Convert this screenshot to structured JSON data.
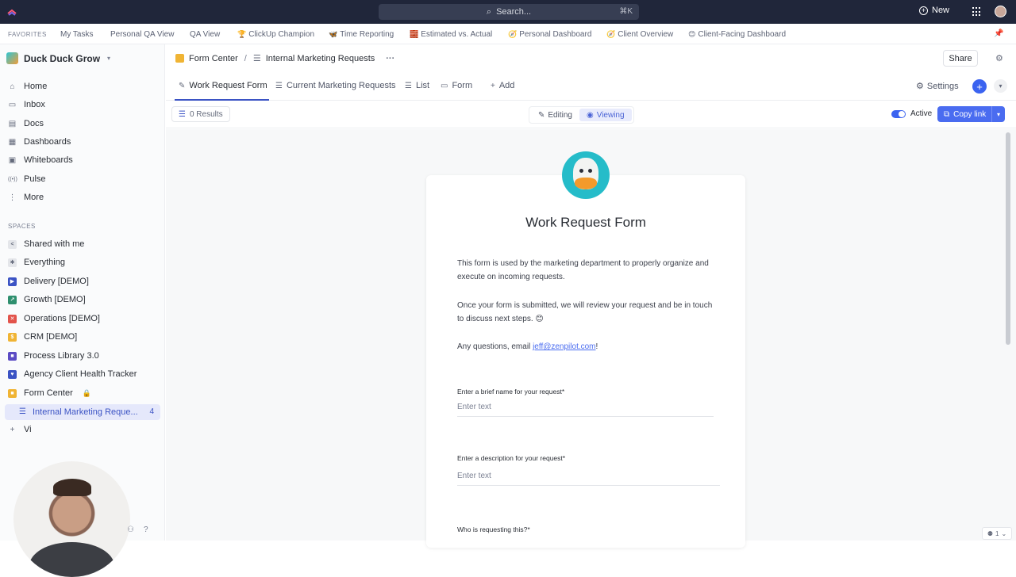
{
  "topbar": {
    "search_placeholder": "Search...",
    "search_shortcut": "⌘K",
    "new_label": "New"
  },
  "favorites": {
    "title": "FAVORITES",
    "items": [
      {
        "label": "My Tasks",
        "emoji": ""
      },
      {
        "label": "Personal QA View",
        "emoji": ""
      },
      {
        "label": "QA View",
        "emoji": ""
      },
      {
        "label": "ClickUp Champion",
        "emoji": "🏆"
      },
      {
        "label": "Time Reporting",
        "emoji": "🦋"
      },
      {
        "label": "Estimated vs. Actual",
        "emoji": "🧱"
      },
      {
        "label": "Personal Dashboard",
        "emoji": "🧭"
      },
      {
        "label": "Client Overview",
        "emoji": "🧭"
      },
      {
        "label": "Client-Facing Dashboard",
        "emoji": "😊"
      }
    ]
  },
  "sidebar": {
    "workspace": "Duck Duck Grow",
    "nav": [
      {
        "label": "Home",
        "icon": "⌂"
      },
      {
        "label": "Inbox",
        "icon": "▭"
      },
      {
        "label": "Docs",
        "icon": "▤"
      },
      {
        "label": "Dashboards",
        "icon": "▦"
      },
      {
        "label": "Whiteboards",
        "icon": "▣"
      },
      {
        "label": "Pulse",
        "icon": "((•))"
      },
      {
        "label": "More",
        "icon": "⋮"
      }
    ],
    "spaces_title": "SPACES",
    "spaces": [
      {
        "label": "Shared with me",
        "icon": "<",
        "color": "#e4e6ea"
      },
      {
        "label": "Everything",
        "icon": "✱",
        "color": "#e4e6ea"
      },
      {
        "label": "Delivery [DEMO]",
        "icon": "▶",
        "color": "#3b53c4"
      },
      {
        "label": "Growth [DEMO]",
        "icon": "↗",
        "color": "#2e8f6e"
      },
      {
        "label": "Operations [DEMO]",
        "icon": "✕",
        "color": "#e2534b"
      },
      {
        "label": "CRM [DEMO]",
        "icon": "$",
        "color": "#f0b434"
      },
      {
        "label": "Process Library 3.0",
        "icon": "■",
        "color": "#5b4bc4"
      },
      {
        "label": "Agency Client Health Tracker",
        "icon": "♥",
        "color": "#3b53c4"
      },
      {
        "label": "Form Center",
        "icon": "■",
        "color": "#f0b434"
      }
    ],
    "active_item": {
      "label": "Internal Marketing Reque...",
      "count": "4"
    },
    "partial_item": "Vi"
  },
  "header": {
    "breadcrumb_parent": "Form Center",
    "breadcrumb_current": "Internal Marketing Requests",
    "share_label": "Share"
  },
  "tabs": [
    {
      "label": "Work Request Form",
      "icon": "✎"
    },
    {
      "label": "Current Marketing Requests",
      "icon": "☰"
    },
    {
      "label": "List",
      "icon": "☰"
    },
    {
      "label": "Form",
      "icon": "▭"
    },
    {
      "label": "Add",
      "icon": "+"
    }
  ],
  "settings_label": "Settings",
  "toolbar": {
    "results": "0 Results",
    "editing": "Editing",
    "viewing": "Viewing",
    "active_label": "Active",
    "copy_link": "Copy link"
  },
  "form": {
    "title": "Work Request Form",
    "para1": "This form is used by the marketing department to properly organize and execute on incoming requests.",
    "para2": "Once your form is submitted, we will review your request and be in touch to discuss next steps. 😊",
    "para3_prefix": "Any questions, email ",
    "para3_link": "jeff@zenpilot.com",
    "para3_suffix": "!",
    "q1_label": "Enter a brief name for your request*",
    "q1_placeholder": "Enter text",
    "q2_label": "Enter a description for your request*",
    "q2_placeholder": "Enter text",
    "q3_label": "Who is requesting this?*"
  },
  "corner_badge": "1"
}
